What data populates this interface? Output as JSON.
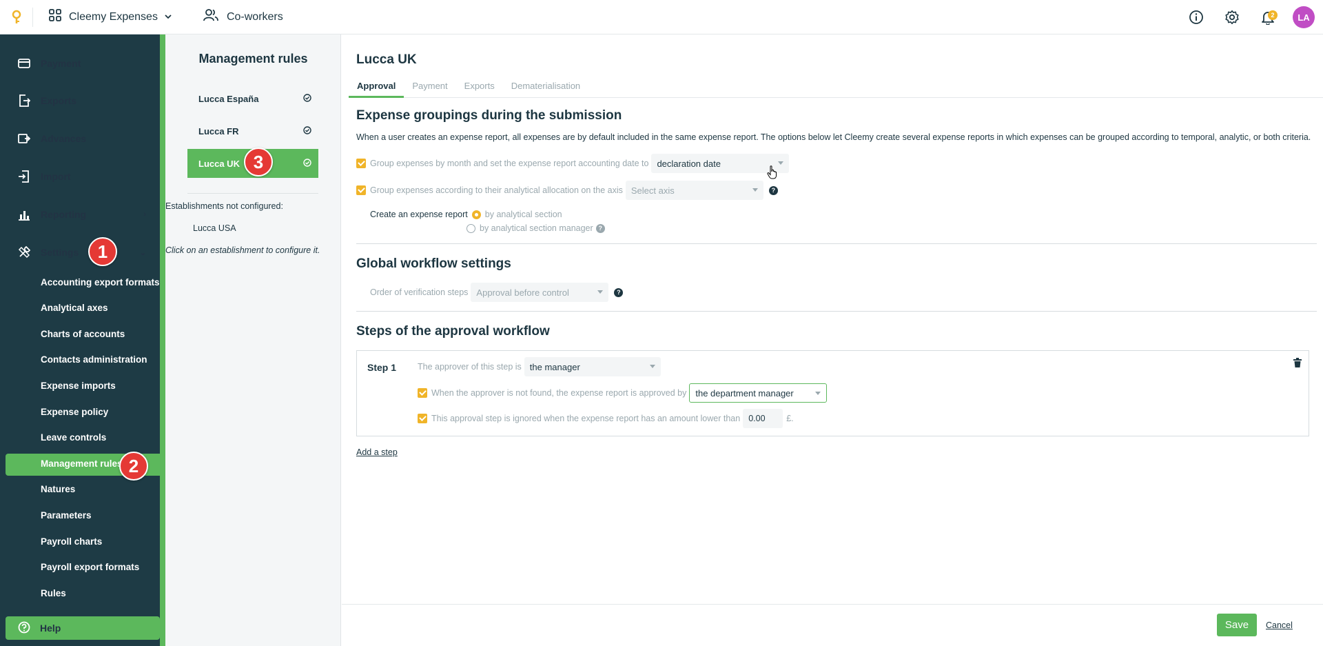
{
  "topbar": {
    "app_name": "Cleemy Expenses",
    "coworkers_label": "Co-workers",
    "notification_count": "2",
    "avatar_initials": "LA",
    "avatar_color": "#c04dc4"
  },
  "sidebar": {
    "main_items": [
      {
        "label": "Payment",
        "icon": "card-icon"
      },
      {
        "label": "Exports",
        "icon": "export-icon"
      },
      {
        "label": "Advances",
        "icon": "advances-icon"
      },
      {
        "label": "Import",
        "icon": "import-icon"
      },
      {
        "label": "Reporting",
        "icon": "chart-icon"
      },
      {
        "label": "Settings",
        "icon": "tools-icon"
      }
    ],
    "sub_items": [
      "Accounting export formats",
      "Analytical axes",
      "Charts of accounts",
      "Contacts administration",
      "Expense imports",
      "Expense policy",
      "Leave controls",
      "Management rules",
      "Natures",
      "Parameters",
      "Payroll charts",
      "Payroll export formats",
      "Rules"
    ],
    "help_label": "Help"
  },
  "callouts": [
    "1",
    "2",
    "3"
  ],
  "establishments": {
    "title": "Management rules",
    "items": [
      "Lucca España",
      "Lucca FR",
      "Lucca UK"
    ],
    "not_configured_label": "Establishments not configured:",
    "not_configured_items": [
      "Lucca USA"
    ],
    "hint": "Click on an establishment to configure it."
  },
  "main": {
    "title": "Lucca UK",
    "tabs": [
      "Approval",
      "Payment",
      "Exports",
      "Dematerialisation"
    ],
    "grouping": {
      "title": "Expense groupings during the submission",
      "description": "When a user creates an expense report, all expenses are by default included in the same expense report. The options below let Cleemy create several expense reports in which expenses can be grouped according to temporal, analytic, or both criteria.",
      "by_month_label": "Group expenses by month and set the expense report accounting date to",
      "by_month_value": "declaration date",
      "by_axis_label": "Group expenses according to their analytical allocation on the axis",
      "by_axis_value": "Select axis",
      "create_label": "Create an expense report",
      "option_section": "by analytical section",
      "option_manager": "by analytical section manager"
    },
    "workflow": {
      "title": "Global workflow settings",
      "order_label": "Order of verification steps",
      "order_value": "Approval before control"
    },
    "steps": {
      "title": "Steps of the approval workflow",
      "step_label": "Step 1",
      "approver_label": "The approver of this step is",
      "approver_value": "the manager",
      "fallback_label": "When the approver is not found, the expense report is approved by",
      "fallback_value": "the department manager",
      "ignore_label": "This approval step is ignored when the expense report has an amount lower than",
      "ignore_amount": "0.00",
      "currency": "£.",
      "add_step": "Add a step"
    },
    "save_label": "Save",
    "cancel_label": "Cancel"
  },
  "colors": {
    "sidebar_bg": "#1e3b45",
    "accent_green": "#5cb85c",
    "checkbox_orange": "#f0b429",
    "callout_red": "#e53935"
  }
}
